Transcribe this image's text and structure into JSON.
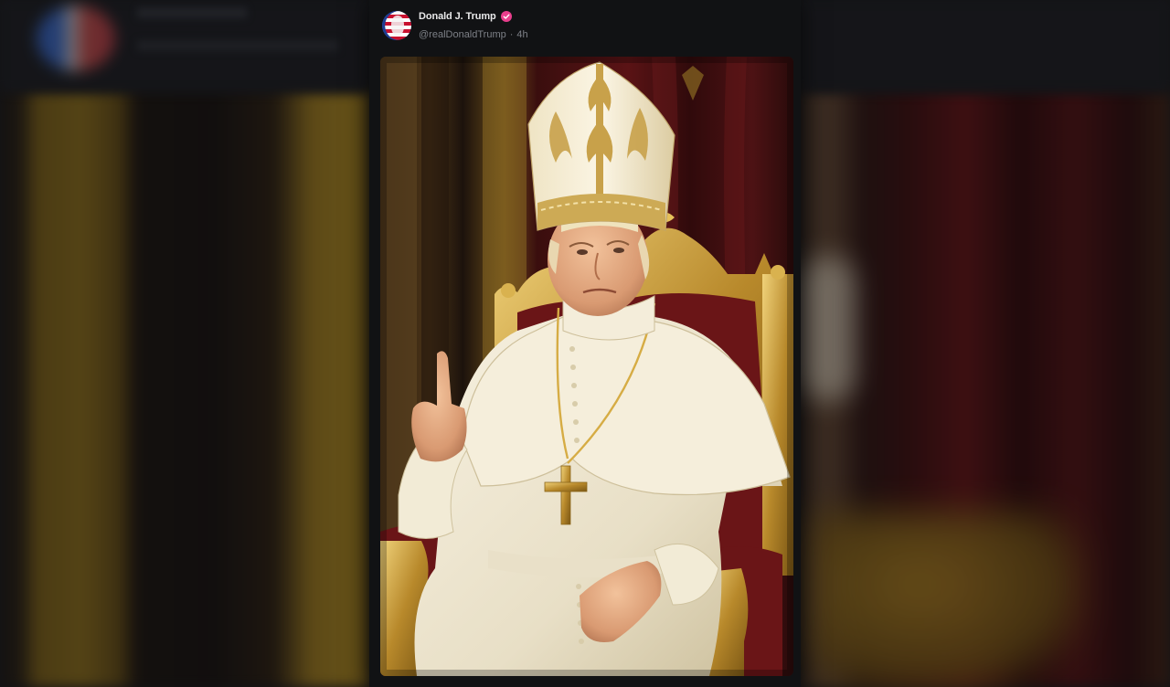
{
  "post": {
    "author": {
      "display_name": "Donald J. Trump",
      "handle": "@realDonaldTrump",
      "separator": "·",
      "timestamp": "4h",
      "verified": true,
      "verified_badge_color": "#e83e8c",
      "avatar_icon": "us-flag-portrait-icon"
    },
    "media": {
      "type": "image",
      "icon": "papal-portrait-image"
    }
  },
  "colors": {
    "background": "#14161a",
    "card": "#111214",
    "name_text": "#e9e9ea",
    "muted_text": "#7d8087"
  }
}
